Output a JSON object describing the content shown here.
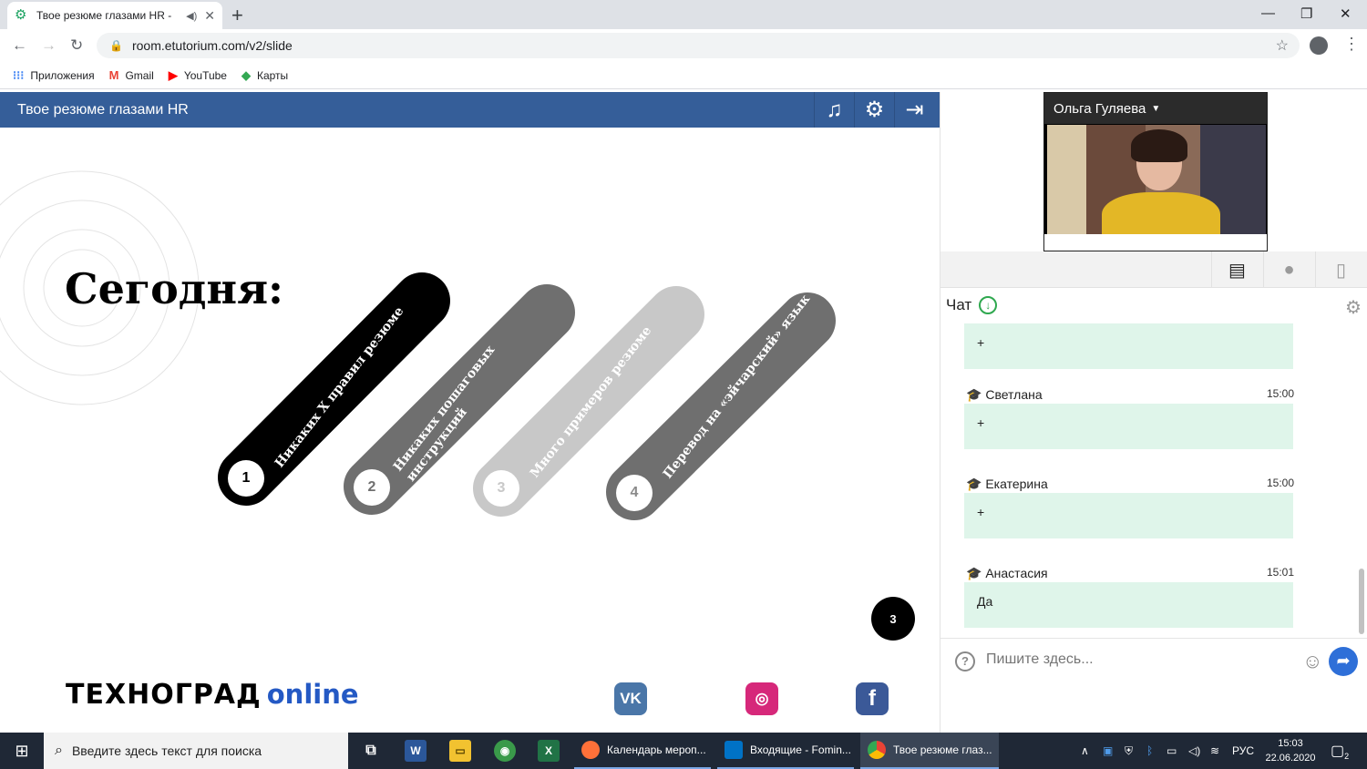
{
  "browser": {
    "tab_title": "Твое резюме глазами HR -",
    "url": "room.etutorium.com/v2/slide",
    "bookmarks": [
      {
        "label": "Приложения",
        "icon": "apps-icon",
        "color": "#4285f4"
      },
      {
        "label": "Gmail",
        "icon": "gmail-icon",
        "color": "#ea4335"
      },
      {
        "label": "YouTube",
        "icon": "youtube-icon",
        "color": "#ff0000"
      },
      {
        "label": "Карты",
        "icon": "maps-icon",
        "color": "#34a853"
      }
    ]
  },
  "webinar": {
    "title": "Твое резюме глазами HR",
    "header_icons": [
      "music-icon",
      "settings-icon",
      "exit-icon"
    ],
    "accent": "#355e99"
  },
  "slide": {
    "heading": "Сегодня:",
    "items": [
      {
        "num": "1",
        "label_lines": [
          "Никаких Х правил резюме"
        ],
        "color": "#000000",
        "num_color": "#000000"
      },
      {
        "num": "2",
        "label_lines": [
          "Никаких пошаговых",
          "инструкций"
        ],
        "color": "#6f6f6f",
        "num_color": "#6f6f6f"
      },
      {
        "num": "3",
        "label_lines": [
          "Много примеров резюме"
        ],
        "color": "#c8c8c8",
        "num_color": "#c8c8c8"
      },
      {
        "num": "4",
        "label_lines": [
          "Перевод на «эйчарский» язык"
        ],
        "color": "#6f6f6f",
        "num_color": "#8a8a8a"
      }
    ],
    "page_number": "3",
    "logo_main": "ТЕХНОГРАД",
    "logo_sub": "online",
    "socials": [
      {
        "name": "vk-icon",
        "glyph": "VK",
        "color": "#4a76a8"
      },
      {
        "name": "instagram-icon",
        "glyph": "◎",
        "color": "#d6287a"
      },
      {
        "name": "facebook-icon",
        "glyph": "f",
        "color": "#3b5998"
      }
    ]
  },
  "presenter": {
    "name": "Ольга Гуляева"
  },
  "chat": {
    "title": "Чат",
    "messages": [
      {
        "author": "",
        "time": "",
        "text": "+"
      },
      {
        "author": "Светлана",
        "time": "15:00",
        "text": "+"
      },
      {
        "author": "Екатерина",
        "time": "15:00",
        "text": "+"
      },
      {
        "author": "Анастасия",
        "time": "15:01",
        "text": "Да"
      }
    ],
    "input_placeholder": "Пишите здесь..."
  },
  "taskbar": {
    "search_placeholder": "Введите здесь текст для поиска",
    "apps": [
      {
        "label": "Календарь мероп...",
        "icon": "firefox-icon",
        "color": "#ff7139"
      },
      {
        "label": "Входящие - Fomin...",
        "icon": "outlook-icon",
        "color": "#0072c6"
      },
      {
        "label": "Твое резюме глаз...",
        "icon": "chrome-icon",
        "color": "#4285f4"
      }
    ],
    "language": "РУС",
    "time": "15:03",
    "date": "22.06.2020",
    "notifications": "2"
  }
}
